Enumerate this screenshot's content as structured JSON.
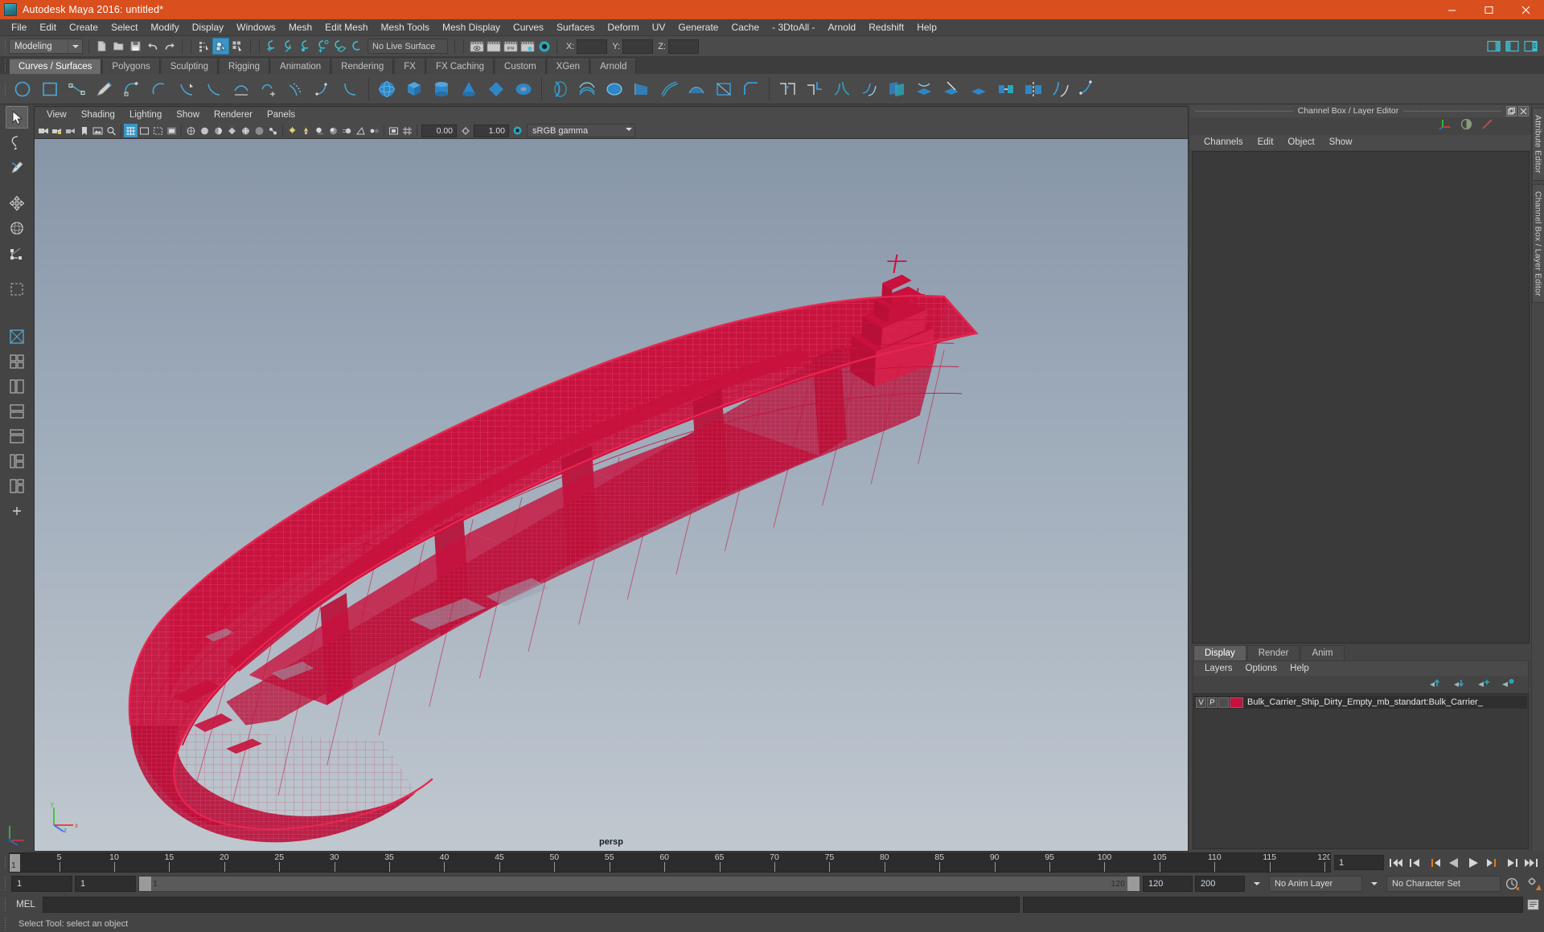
{
  "window": {
    "title": "Autodesk Maya 2016: untitled*",
    "app_icon": "maya-logo-icon",
    "buttons": {
      "minimize": "minimize-icon",
      "maximize": "maximize-icon",
      "close": "close-icon"
    },
    "titlebar_color": "#d94f1e"
  },
  "menubar": {
    "items": [
      "File",
      "Edit",
      "Create",
      "Select",
      "Modify",
      "Display",
      "Windows",
      "Mesh",
      "Edit Mesh",
      "Mesh Tools",
      "Mesh Display",
      "Curves",
      "Surfaces",
      "Deform",
      "UV",
      "Generate",
      "Cache",
      "- 3DtoAll -",
      "Arnold",
      "Redshift",
      "Help"
    ]
  },
  "statusbar": {
    "menu_set": "Modeling",
    "live_surface": "No Live Surface",
    "coords": {
      "x_label": "X:",
      "x_value": "",
      "y_label": "Y:",
      "y_value": "",
      "z_label": "Z:",
      "z_value": ""
    },
    "icons": [
      "new-scene-icon",
      "open-scene-icon",
      "save-scene-icon",
      "undo-icon",
      "redo-icon",
      "select-by-hierarchy-icon",
      "select-by-object-type-icon",
      "select-by-component-type-icon",
      "snap-to-grid-icon",
      "snap-to-curve-icon",
      "snap-to-point-icon",
      "snap-to-projected-center-icon",
      "snap-to-view-plane-icon",
      "make-live-icon",
      "show-hide-render-view-icon",
      "render-current-frame-icon",
      "ipr-render-icon",
      "render-settings-icon",
      "toggle-hypershade-icon",
      "show-attribute-editor-icon",
      "show-tool-settings-icon",
      "show-channel-box-icon"
    ]
  },
  "shelf": {
    "tabs": [
      "Curves / Surfaces",
      "Polygons",
      "Sculpting",
      "Rigging",
      "Animation",
      "Rendering",
      "FX",
      "FX Caching",
      "Custom",
      "XGen",
      "Arnold"
    ],
    "active_tab": "Curves / Surfaces",
    "icons": [
      "nurbs-circle-icon",
      "nurbs-square-icon",
      "ep-curve-tool-icon",
      "pencil-curve-tool-icon",
      "two-point-circular-arc-icon",
      "three-point-circular-arc-icon",
      "curve-cv-icon",
      "curve-fillet-icon",
      "curve-attach-icon",
      "curve-detach-icon",
      "curve-offset-icon",
      "curve-rebuild-icon",
      "curve-insert-knot-icon",
      "nurbs-sphere-icon",
      "nurbs-cube-icon",
      "nurbs-cylinder-icon",
      "nurbs-cone-icon",
      "nurbs-plane-icon",
      "nurbs-torus-icon",
      "revolve-icon",
      "loft-icon",
      "planar-icon",
      "extrude-icon",
      "birail-icon",
      "boundary-icon",
      "square-surface-icon",
      "bevel-icon",
      "surface-fillet-icon",
      "circular-fillet-icon",
      "freeform-fillet-icon",
      "fillet-blend-icon",
      "intersect-surfaces-icon",
      "project-curve-icon",
      "trim-tool-icon",
      "untrim-surfaces-icon",
      "surface-attach-icon",
      "surface-detach-icon",
      "align-surfaces-icon",
      "surface-rebuild-icon"
    ]
  },
  "toolbox": {
    "tools": [
      {
        "name": "select-tool",
        "selected": true
      },
      {
        "name": "lasso-select-tool",
        "selected": false
      },
      {
        "name": "paint-select-tool",
        "selected": false
      },
      {
        "name": "move-tool",
        "selected": false
      },
      {
        "name": "rotate-tool",
        "selected": false
      },
      {
        "name": "scale-tool",
        "selected": false
      },
      {
        "name": "last-tool-used",
        "selected": false
      }
    ],
    "layouts": [
      "single-perspective-layout-icon",
      "four-view-layout-icon",
      "outliner-persp-layout-icon",
      "persp-graph-editor-layout-icon",
      "hypershade-persp-layout-icon",
      "persp-two-stack-layout-icon",
      "outliner-persp-graph-layout-icon",
      "add-layout-icon"
    ],
    "axis_gizmo": "origin-axis-icon"
  },
  "viewport": {
    "menus": [
      "View",
      "Shading",
      "Lighting",
      "Show",
      "Renderer",
      "Panels"
    ],
    "camera_label": "persp",
    "exposure_value": "0.00",
    "gamma_value": "1.00",
    "color_management": "sRGB gamma",
    "toolbar_icons": [
      "select-camera-icon",
      "lock-camera-icon",
      "camera-attributes-icon",
      "bookmark-icon",
      "image-plane-icon",
      "two-d-pan-zoom-icon",
      "grid-icon",
      "film-gate-icon",
      "resolution-gate-icon",
      "gate-mask-icon",
      "wireframe-shading-icon",
      "smooth-shade-all-icon",
      "smooth-shade-selected-icon",
      "flat-shade-icon",
      "wireframe-on-shaded-icon",
      "xray-icon",
      "xray-joints-icon",
      "use-default-lighting-icon",
      "use-all-lights-icon",
      "shadows-icon",
      "ambient-occlusion-icon",
      "motion-blur-icon",
      "multisample-anti-aliasing-icon",
      "depth-of-field-icon",
      "isolate-select-icon",
      "grid-display-icon",
      "exposure-icon",
      "gamma-icon",
      "color-management-toggle-icon"
    ],
    "model": {
      "name": "Bulk_Carrier_Ship_Dirty_Empty",
      "display": "wireframe-on-shaded",
      "wire_color": "#c8113d",
      "selected": true
    }
  },
  "channel_box": {
    "panel_title": "Channel Box / Layer Editor",
    "menus": [
      "Channels",
      "Edit",
      "Object",
      "Show"
    ],
    "header_icons": [
      "show-transform-attributes-icon",
      "show-shape-attributes-icon",
      "show-input-output-icon"
    ],
    "window_buttons": [
      "undock-icon",
      "close-panel-icon"
    ],
    "content": ""
  },
  "layer_editor": {
    "tabs": [
      "Display",
      "Render",
      "Anim"
    ],
    "active_tab": "Display",
    "menus": [
      "Layers",
      "Options",
      "Help"
    ],
    "buttons": [
      "move-layer-up-icon",
      "move-layer-down-icon",
      "new-layer-icon",
      "new-layer-from-selected-icon"
    ],
    "layers": [
      {
        "visibility": "V",
        "playback": "P",
        "state": "",
        "color": "#c8113d",
        "name": "Bulk_Carrier_Ship_Dirty_Empty_mb_standart:Bulk_Carrier_"
      }
    ]
  },
  "right_tabs": [
    "Attribute Editor",
    "Channel Box / Layer Editor"
  ],
  "timeline": {
    "start": 1,
    "end": 120,
    "current_frame": "1",
    "tick_labels": [
      "5",
      "10",
      "15",
      "20",
      "25",
      "30",
      "35",
      "40",
      "45",
      "50",
      "55",
      "60",
      "65",
      "70",
      "75",
      "80",
      "85",
      "90",
      "95",
      "100",
      "105",
      "110",
      "115",
      "120"
    ],
    "playback_buttons": [
      "go-to-start-icon",
      "step-back-frame-icon",
      "step-back-key-icon",
      "play-backwards-icon",
      "play-forwards-icon",
      "step-forward-key-icon",
      "step-forward-frame-icon",
      "go-to-end-icon"
    ]
  },
  "range": {
    "anim_start": "1",
    "range_start": "1",
    "slider_start": "1",
    "slider_end": "120",
    "range_end": "120",
    "anim_end": "200",
    "anim_layer": "No Anim Layer",
    "character_set": "No Character Set",
    "auto_key_icon": "auto-keyframe-icon",
    "prefs_icon": "animation-preferences-icon"
  },
  "command_line": {
    "label": "MEL",
    "input_value": "",
    "output_value": "",
    "script_editor_icon": "script-editor-icon"
  },
  "help_line": {
    "text": "Select Tool: select an object"
  }
}
